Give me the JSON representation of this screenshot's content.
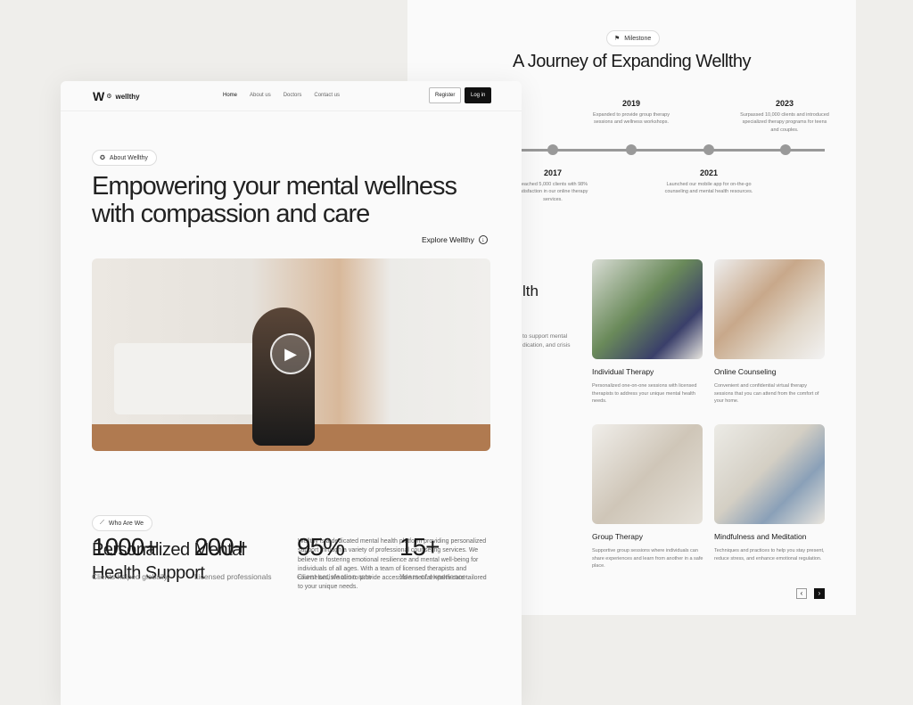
{
  "milestone": {
    "badge": "Milestone",
    "title": "A Journey of Expanding Wellthy",
    "items": [
      {
        "year": "2017",
        "desc": "Reached 5,000 clients with 98% satisfaction in our online therapy services."
      },
      {
        "year": "2019",
        "desc": "Expanded to provide group therapy sessions and wellness workshops."
      },
      {
        "year": "2021",
        "desc": "Launched our mobile app for on-the-go counseling and mental health resources."
      },
      {
        "year": "2023",
        "desc": "Surpassed 10,000 clients and introduced specialized therapy programs for teens and couples."
      }
    ]
  },
  "services_partial": {
    "heading": "lth",
    "text1": "to support mental",
    "text2": "dication, and crisis"
  },
  "services": [
    {
      "title": "Individual Therapy",
      "desc": "Personalized one-on-one sessions with licensed therapists to address your unique mental health needs."
    },
    {
      "title": "Online Counseling",
      "desc": "Convenient and confidential virtual therapy sessions that you can attend from the comfort of your home."
    },
    {
      "title": "Group Therapy",
      "desc": "Supportive group sessions where individuals can share experiences and learn from another in a safe place."
    },
    {
      "title": "Mindfulness and Meditation",
      "desc": "Techniques and practices to help you stay present, reduce stress, and enhance emotional regulation."
    }
  ],
  "nav": {
    "brand": "wellthy",
    "links": [
      "Home",
      "About us",
      "Doctors",
      "Contact us"
    ],
    "register": "Register",
    "login": "Log in"
  },
  "hero": {
    "badge": "About Wellthy",
    "title_1": "Empowering your mental wellness",
    "title_2": "with compassion and care",
    "explore": "Explore Wellthy"
  },
  "about": {
    "badge": "Who Are We",
    "title_1": "Personalized Mental",
    "title_2": "Health Support",
    "body": "Wellthy is a dedicated mental health platform providing personalized support through a variety of professional counseling services. We believe in fostering emotional resilience and mental well-being for individuals of all ages. With a team of licensed therapists and counselors, we aim to provide accessible mental health care tailored to your unique needs."
  },
  "stats": [
    {
      "value": "1000+",
      "label": "Clients helped globally"
    },
    {
      "value": "200+",
      "label": "Licensed professionals"
    },
    {
      "value": "95%",
      "label": "Client satisfaction rate"
    },
    {
      "value": "15+",
      "label": "Years of experience"
    }
  ]
}
